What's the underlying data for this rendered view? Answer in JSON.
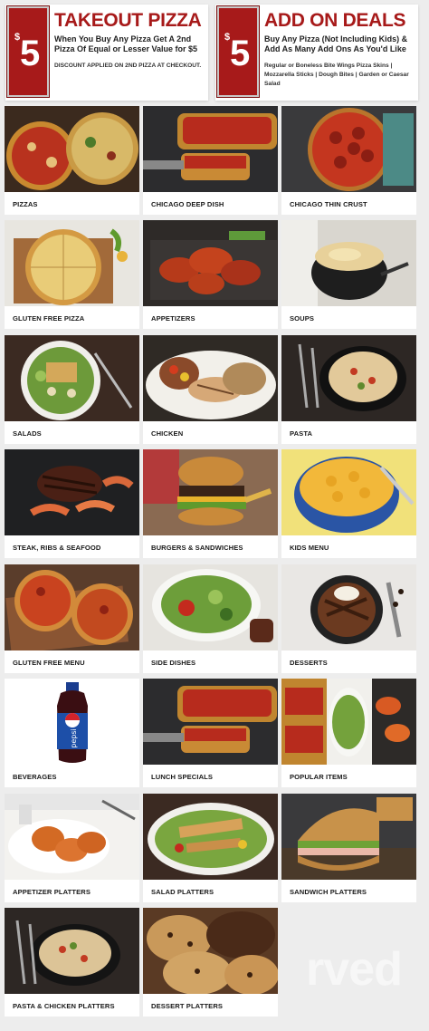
{
  "promos": [
    {
      "currency": "$",
      "amount": "5",
      "title": "TAKEOUT PIZZA",
      "subtitle": "When You Buy Any Pizza Get A 2nd Pizza Of Equal or Lesser Value for $5",
      "note": "DISCOUNT APPLIED ON 2ND PIZZA AT CHECKOUT."
    },
    {
      "currency": "$",
      "amount": "5",
      "title": "ADD ON DEALS",
      "subtitle": "Buy Any Pizza (Not Including Kids) & Add As Many Add Ons As You'd Like",
      "note": "Regular or Boneless Bite Wings Pizza Skins | Mozzarella Sticks | Dough Bites | Garden or Caesar Salad"
    }
  ],
  "menu": [
    {
      "label": "PIZZAS",
      "icon": "pizza-photo"
    },
    {
      "label": "CHICAGO DEEP DISH",
      "icon": "deep-dish-photo"
    },
    {
      "label": "CHICAGO THIN CRUST",
      "icon": "thin-crust-photo"
    },
    {
      "label": "GLUTEN FREE PIZZA",
      "icon": "gluten-free-pizza-photo"
    },
    {
      "label": "APPETIZERS",
      "icon": "wings-photo"
    },
    {
      "label": "SOUPS",
      "icon": "soup-photo"
    },
    {
      "label": "SALADS",
      "icon": "salad-photo"
    },
    {
      "label": "CHICKEN",
      "icon": "chicken-photo"
    },
    {
      "label": "PASTA",
      "icon": "pasta-photo"
    },
    {
      "label": "STEAK, RIBS & SEAFOOD",
      "icon": "steak-photo"
    },
    {
      "label": "BURGERS & SANDWICHES",
      "icon": "burger-photo"
    },
    {
      "label": "KIDS MENU",
      "icon": "mac-cheese-photo"
    },
    {
      "label": "GLUTEN FREE MENU",
      "icon": "gluten-free-menu-photo"
    },
    {
      "label": "SIDE DISHES",
      "icon": "side-salad-photo"
    },
    {
      "label": "DESSERTS",
      "icon": "dessert-photo"
    },
    {
      "label": "BEVERAGES",
      "icon": "pepsi-bottle-photo"
    },
    {
      "label": "LUNCH SPECIALS",
      "icon": "lunch-special-photo"
    },
    {
      "label": "POPULAR ITEMS",
      "icon": "popular-items-photo"
    },
    {
      "label": "APPETIZER PLATTERS",
      "icon": "appetizer-platter-photo"
    },
    {
      "label": "SALAD PLATTERS",
      "icon": "salad-platter-photo"
    },
    {
      "label": "SANDWICH PLATTERS",
      "icon": "sandwich-platter-photo"
    },
    {
      "label": "PASTA & CHICKEN PLATTERS",
      "icon": "pasta-platter-photo"
    },
    {
      "label": "DESSERT PLATTERS",
      "icon": "cookie-platter-photo"
    }
  ],
  "watermark": "rved",
  "colors": {
    "brand_red": "#a71a1a",
    "page_bg": "#ededed"
  }
}
